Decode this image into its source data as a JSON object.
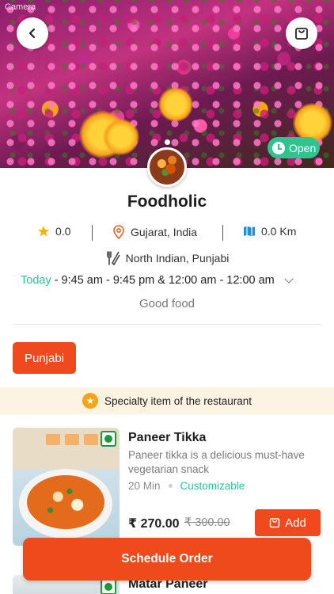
{
  "status_bar": {
    "text": "Camera"
  },
  "hero": {
    "open_label": "Open"
  },
  "restaurant": {
    "name": "Foodholic",
    "rating": "0.0",
    "location": "Gujarat, India",
    "distance": "0.0 Km",
    "cuisines": "North Indian, Punjabi",
    "hours_day": "Today",
    "hours": "- 9:45 am - 9:45 pm & 12:00 am - 12:00 am",
    "description": "Good food"
  },
  "categories": [
    {
      "label": "Punjabi"
    }
  ],
  "specialty_banner": "Specialty item of the restaurant",
  "menu_items": [
    {
      "name": "Paneer Tikka",
      "description": "Paneer tikka is a delicious must-have vegetarian snack",
      "time": "20 Min",
      "customizable": "Customizable",
      "price": "₹ 270.00",
      "original_price": "₹ 300.00",
      "add_label": "Add"
    },
    {
      "name": "Matar Paneer"
    }
  ],
  "schedule_button": "Schedule Order",
  "colors": {
    "accent": "#f0491d",
    "open_green": "#2fc38f",
    "veg_green": "#1a9a3a",
    "banner_bg": "#fdf3e3"
  }
}
